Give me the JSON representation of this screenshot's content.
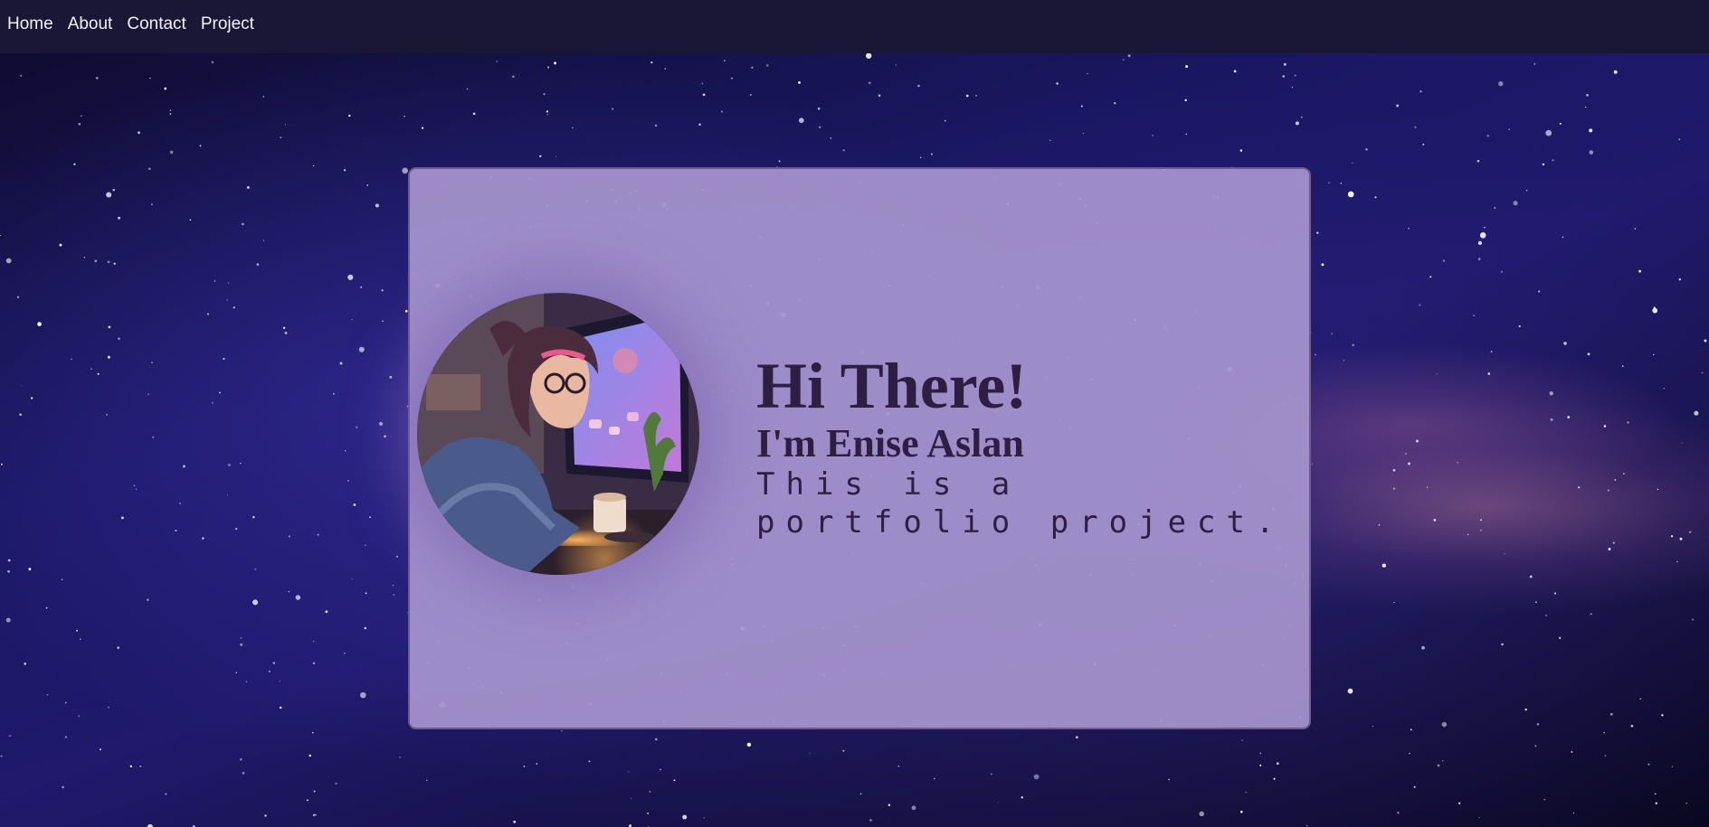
{
  "nav": {
    "items": [
      {
        "label": "Home"
      },
      {
        "label": "About"
      },
      {
        "label": "Contact"
      },
      {
        "label": "Project"
      }
    ]
  },
  "hero": {
    "greeting": "Hi There!",
    "name": "I'm Enise Aslan",
    "description": "This is a portfolio project."
  },
  "colors": {
    "navbar": "#1a1635",
    "card": "#a694ce",
    "text": "#2e1f42"
  }
}
